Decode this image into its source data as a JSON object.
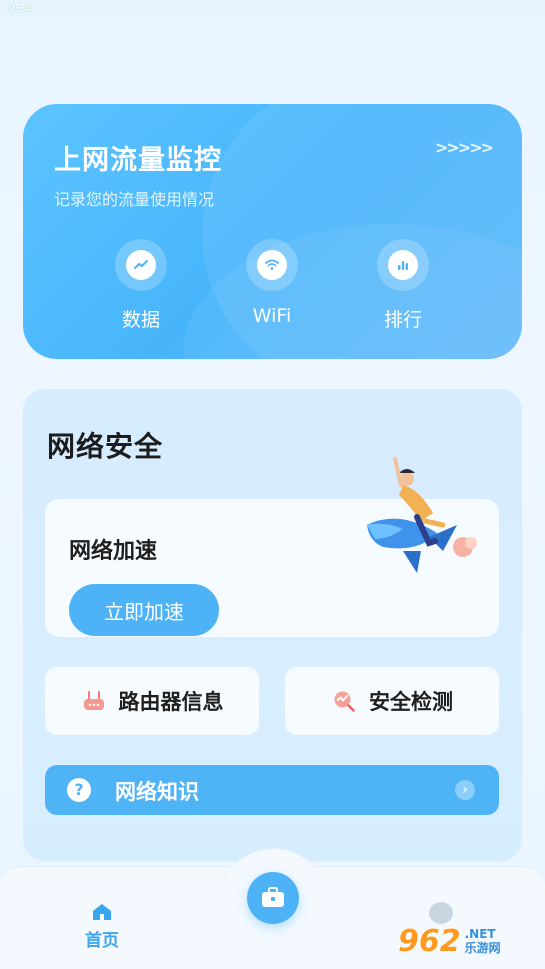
{
  "status_bar": {
    "time": "9:34"
  },
  "traffic_card": {
    "title": "上网流量监控",
    "subtitle": "记录您的流量使用情况",
    "arrows": ">>>>>",
    "items": [
      {
        "label": "数据",
        "icon": "trend-line-icon"
      },
      {
        "label": "WiFi",
        "icon": "wifi-icon"
      },
      {
        "label": "排行",
        "icon": "bar-chart-icon"
      }
    ]
  },
  "security": {
    "title": "网络安全",
    "speed_card": {
      "title": "网络加速",
      "button_label": "立即加速"
    },
    "tools": [
      {
        "label": "路由器信息",
        "icon": "router-icon"
      },
      {
        "label": "安全检测",
        "icon": "scan-check-icon"
      }
    ],
    "knowledge": {
      "label": "网络知识",
      "icon": "question-icon"
    }
  },
  "bottom_nav": {
    "home_label": "首页",
    "center_icon": "toolbox-icon"
  },
  "watermark": {
    "number": "962",
    "suffix": ".NET",
    "text": "乐游网"
  },
  "colors": {
    "accent": "#4db3f6",
    "card_bg": "#5cc4ff",
    "text_dark": "#1f1f1f"
  }
}
